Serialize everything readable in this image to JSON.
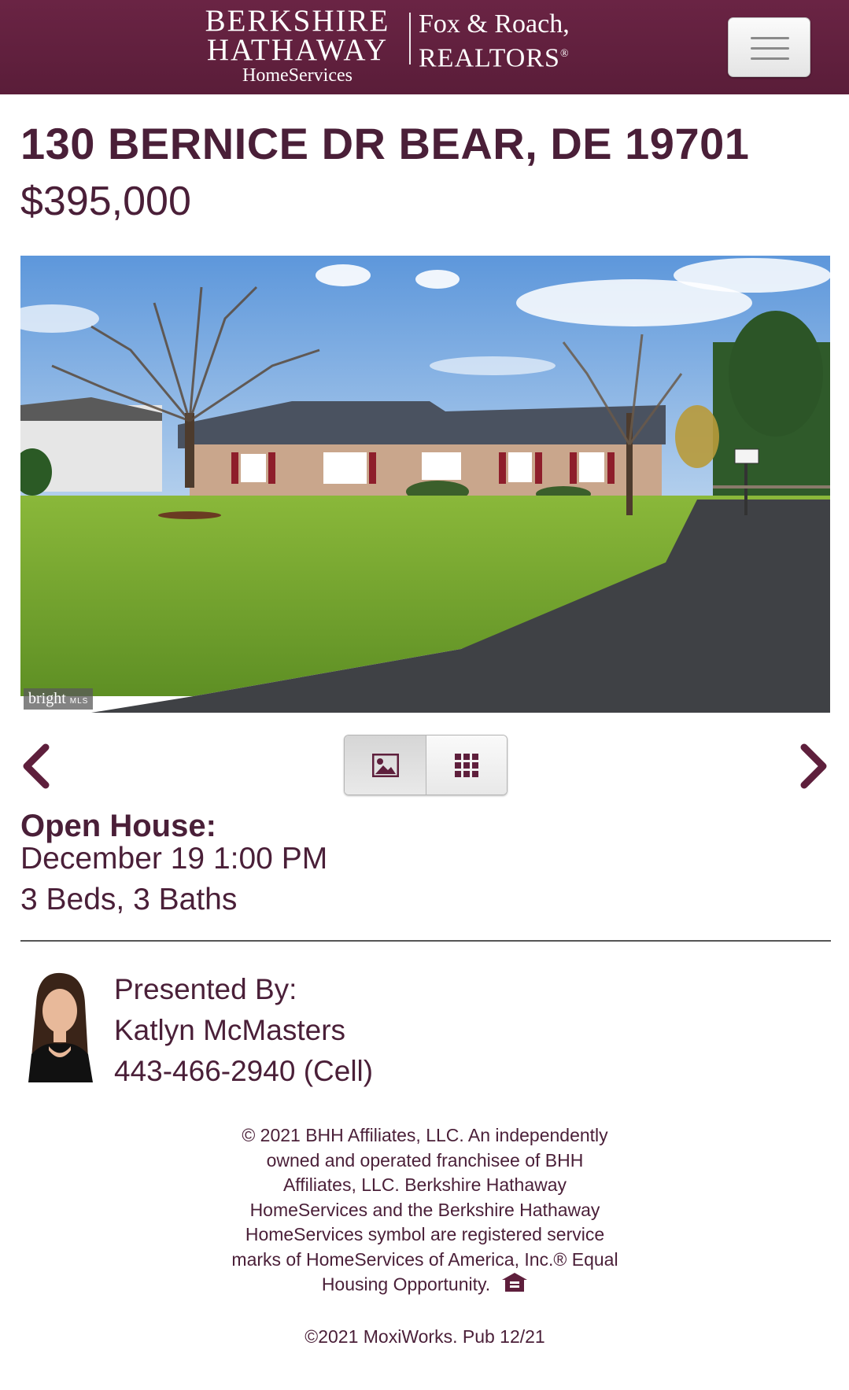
{
  "header": {
    "brand_line1": "BERKSHIRE",
    "brand_line2": "HATHAWAY",
    "brand_line3": "HomeServices",
    "partner_line1": "Fox & Roach,",
    "partner_line2": "REALTORS",
    "partner_mark": "®",
    "menu_icon": "hamburger-icon",
    "brand_color": "#5e1f3c"
  },
  "listing": {
    "address": "130 BERNICE DR BEAR, DE 19701",
    "price": "$395,000",
    "photo_watermark": "bright",
    "photo_watermark_sub": "MLS",
    "open_house_label": "Open House:",
    "open_house_date": "December 19 1:00 PM",
    "beds_baths": "3 Beds, 3 Baths"
  },
  "gallery": {
    "prev_icon": "chevron-left-icon",
    "next_icon": "chevron-right-icon",
    "photo_view_icon": "image-icon",
    "grid_view_icon": "grid-icon"
  },
  "agent": {
    "presented_by": "Presented By:",
    "name": "Katlyn McMasters",
    "phone": "443-466-2940 (Cell)"
  },
  "footer": {
    "legal_line1": "© 2021 BHH Affiliates, LLC. An independently",
    "legal_line2": "owned and operated franchisee of BHH",
    "legal_line3": "Affiliates, LLC. Berkshire Hathaway",
    "legal_line4": "HomeServices and the Berkshire Hathaway",
    "legal_line5": "HomeServices symbol are registered service",
    "legal_line6": "marks of HomeServices of America, Inc.® Equal",
    "legal_line7": "Housing Opportunity.",
    "equal_housing_icon": "equal-housing-icon",
    "copyright": "©2021 MoxiWorks. Pub 12/21"
  }
}
